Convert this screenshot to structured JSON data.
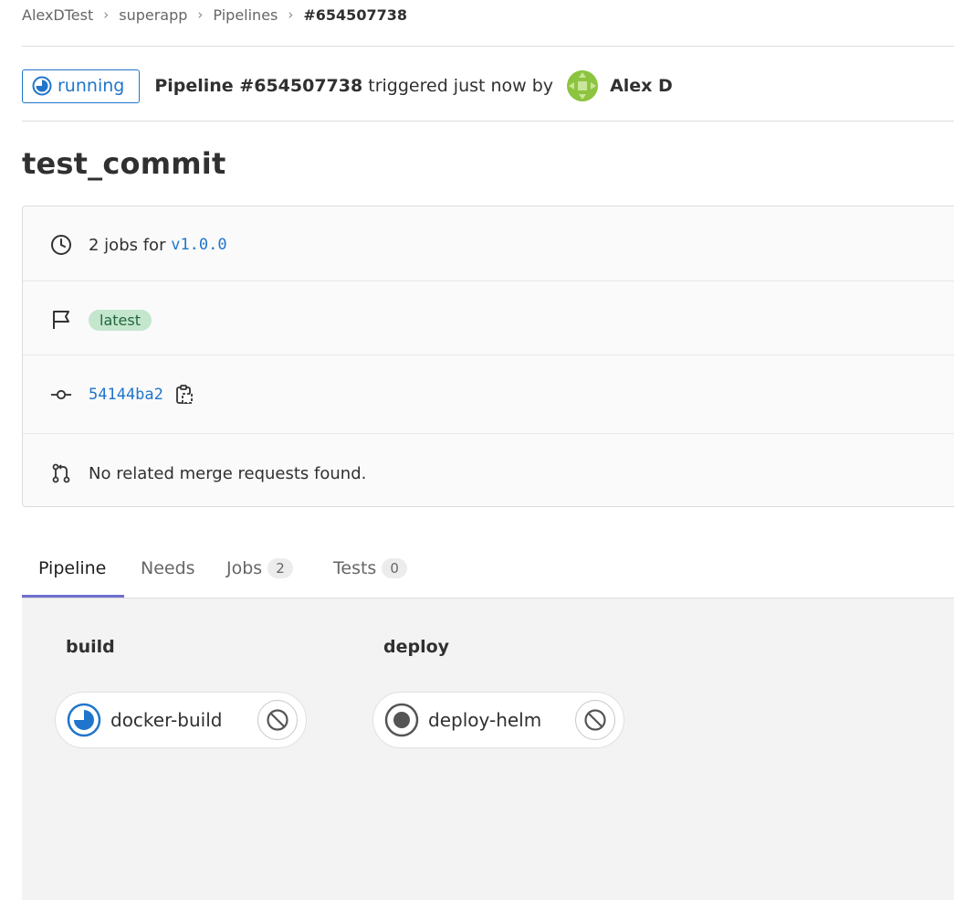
{
  "breadcrumb": {
    "items": [
      "AlexDTest",
      "superapp",
      "Pipelines",
      "#654507738"
    ]
  },
  "header": {
    "status": "running",
    "pipeline_label": "Pipeline #654507738",
    "triggered_text": " triggered just now by",
    "author": "Alex D"
  },
  "commit_title": "test_commit",
  "info": {
    "jobs_prefix": "2 jobs for",
    "ref": "v1.0.0",
    "label": "latest",
    "commit_sha": "54144ba2",
    "merge_requests": "No related merge requests found."
  },
  "tabs": [
    {
      "label": "Pipeline",
      "count": null
    },
    {
      "label": "Needs",
      "count": null
    },
    {
      "label": "Jobs",
      "count": "2"
    },
    {
      "label": "Tests",
      "count": "0"
    }
  ],
  "stages": [
    {
      "title": "build",
      "jobs": [
        {
          "name": "docker-build",
          "status": "running"
        }
      ]
    },
    {
      "title": "deploy",
      "jobs": [
        {
          "name": "deploy-helm",
          "status": "created"
        }
      ]
    }
  ],
  "colors": {
    "accent": "#1f75cb",
    "tab_active": "#6e6fce",
    "label_bg": "#c3e6cd",
    "label_text": "#24663b",
    "avatar": "#8cc43f"
  }
}
